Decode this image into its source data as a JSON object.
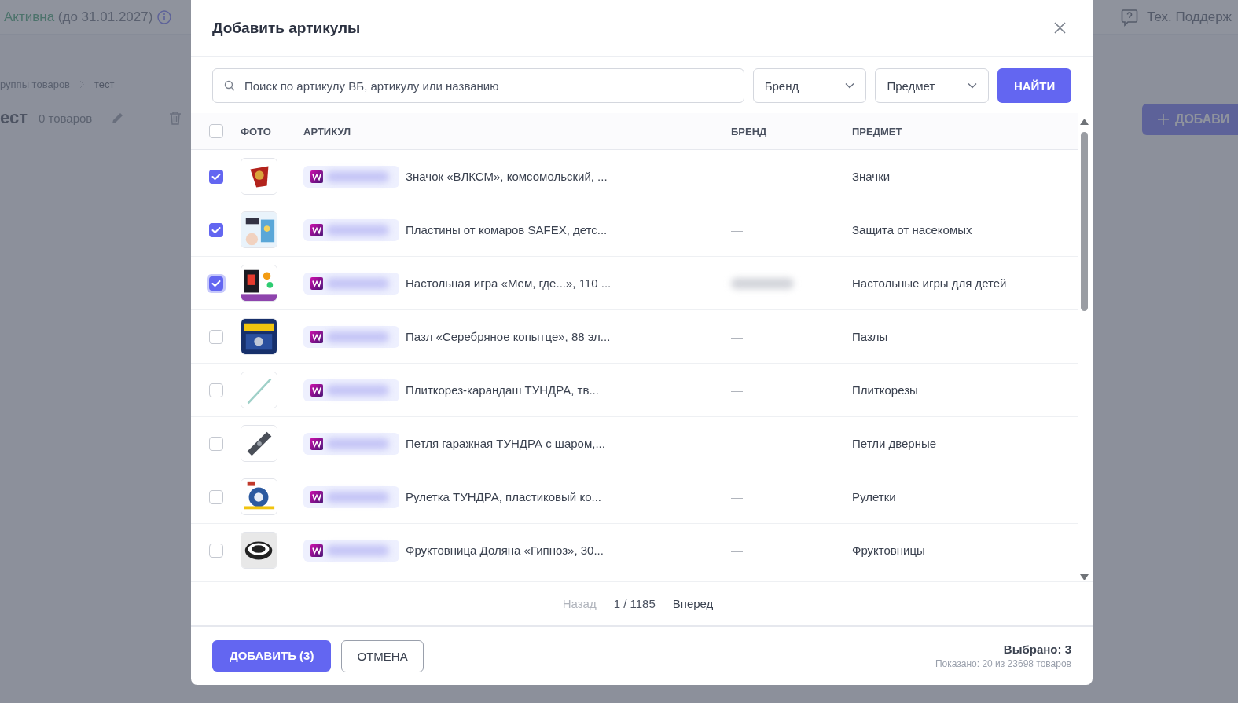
{
  "page": {
    "status": {
      "label": "Активна",
      "period": "(до 31.01.2027)"
    },
    "support": "Тех. Поддерж",
    "breadcrumbs": [
      "руппы товаров",
      "тест"
    ],
    "group": {
      "title": "ест",
      "count": "0 товаров"
    },
    "add_button": "ДОБАВИ"
  },
  "dialog": {
    "title": "Добавить артикулы",
    "search": {
      "placeholder": "Поиск по артикулу ВБ, артикулу или названию"
    },
    "filters": [
      {
        "label": "Бренд"
      },
      {
        "label": "Предмет"
      }
    ],
    "find_button": "НАЙТИ",
    "table": {
      "select_all": {
        "checked": false
      },
      "columns": [
        "ФОТО",
        "АРТИКУЛ",
        "БРЕНД",
        "ПРЕДМЕТ"
      ],
      "rows": [
        {
          "checked": true,
          "focused": false,
          "name": "Значок «ВЛКСМ», комсомольский, ...",
          "brand": "—",
          "brand_blurred": false,
          "subject": "Значки"
        },
        {
          "checked": true,
          "focused": false,
          "name": "Пластины от комаров SAFEX, детс...",
          "brand": "—",
          "brand_blurred": false,
          "subject": "Защита от насекомых"
        },
        {
          "checked": true,
          "focused": true,
          "name": "Настольная игра «Мем, где...», 110 ...",
          "brand_blurred": true,
          "subject": "Настольные игры для детей"
        },
        {
          "checked": false,
          "focused": false,
          "name": "Пазл «Серебряное копытце», 88 эл...",
          "brand": "—",
          "brand_blurred": false,
          "subject": "Пазлы"
        },
        {
          "checked": false,
          "focused": false,
          "name": "Плиткорез-карандаш ТУНДРА, тв...",
          "brand": "—",
          "brand_blurred": false,
          "subject": "Плиткорезы"
        },
        {
          "checked": false,
          "focused": false,
          "name": "Петля гаражная ТУНДРА с шаром,...",
          "brand": "—",
          "brand_blurred": false,
          "subject": "Петли дверные"
        },
        {
          "checked": false,
          "focused": false,
          "name": "Рулетка ТУНДРА, пластиковый ко...",
          "brand": "—",
          "brand_blurred": false,
          "subject": "Рулетки"
        },
        {
          "checked": false,
          "focused": false,
          "name": "Фруктовница Доляна «Гипноз», 30...",
          "brand": "—",
          "brand_blurred": false,
          "subject": "Фруктовницы"
        }
      ]
    },
    "pagination": {
      "prev": {
        "label": "Назад",
        "disabled": true
      },
      "page": "1 / 1185",
      "next": {
        "label": "Вперед",
        "disabled": false
      }
    },
    "footer": {
      "add_button": "ДОБАВИТЬ (3)",
      "cancel_button": "ОТМЕНА",
      "selected": "Выбрано: 3",
      "shown": "Показано: 20 из 23698 товаров"
    }
  }
}
